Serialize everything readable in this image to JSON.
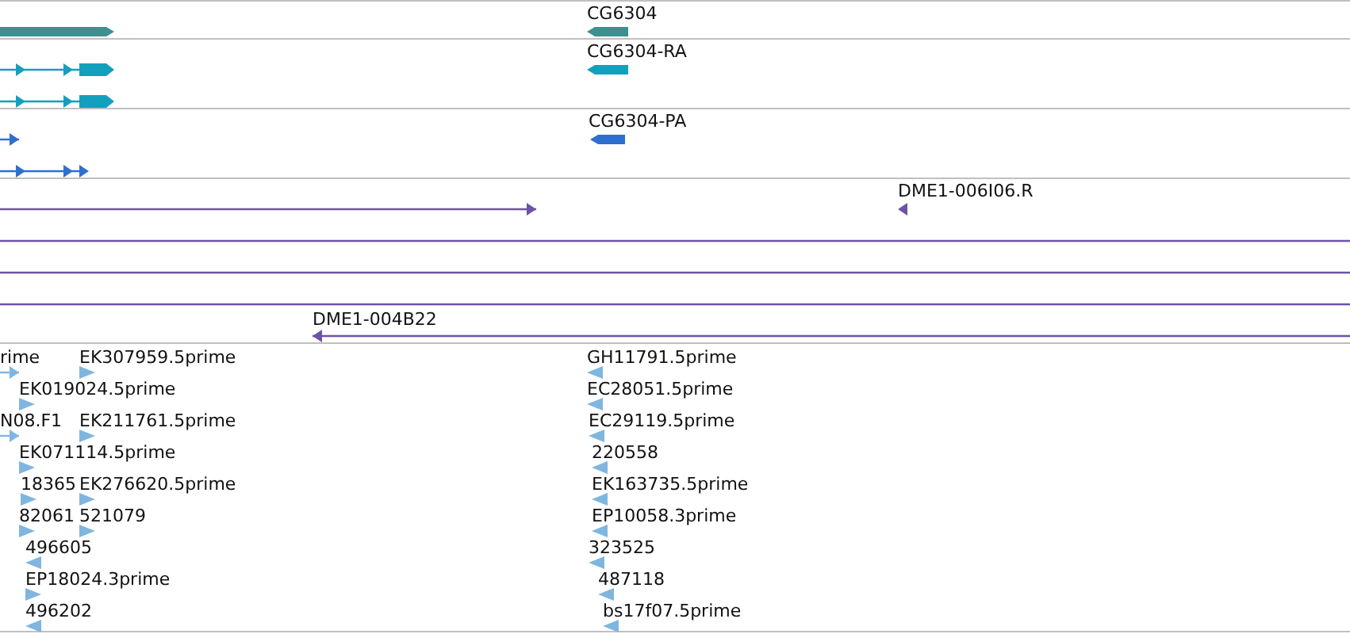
{
  "tracks": [
    {
      "color": "#3e8f8f",
      "features": [
        {
          "kind": "block",
          "forward": true
        },
        {
          "kind": "block",
          "forward": false,
          "label": "CG6304"
        }
      ]
    },
    {
      "color": "#13a0bf",
      "features": [
        {
          "kind": "transcript",
          "forward": true
        },
        {
          "kind": "transcript",
          "forward": true
        },
        {
          "kind": "block",
          "forward": false,
          "label": "CG6304-RA"
        }
      ]
    },
    {
      "color": "#2f6fcf",
      "features": [
        {
          "kind": "line",
          "forward": true
        },
        {
          "kind": "transcript",
          "forward": true
        },
        {
          "kind": "block",
          "forward": false,
          "label": "CG6304-PA"
        }
      ]
    },
    {
      "color": "#6e52a8",
      "features": [
        {
          "kind": "line",
          "forward": true
        },
        {
          "kind": "marker",
          "forward": false,
          "label": "DME1-006I06.R"
        },
        {
          "kind": "rule"
        },
        {
          "kind": "rule"
        },
        {
          "kind": "rule"
        },
        {
          "kind": "line",
          "forward": false,
          "label": "DME1-004B22"
        }
      ]
    },
    {
      "color": "#7fb6e0",
      "features": [
        {
          "kind": "line",
          "forward": true,
          "label": "rime"
        },
        {
          "kind": "marker",
          "forward": true,
          "label": "EK307959.5prime"
        },
        {
          "kind": "marker",
          "forward": false,
          "label": "GH11791.5prime"
        },
        {
          "kind": "marker",
          "forward": true,
          "label": "EK019024.5prime"
        },
        {
          "kind": "marker",
          "forward": false,
          "label": "EC28051.5prime"
        },
        {
          "kind": "line",
          "forward": true,
          "label": "N08.F1"
        },
        {
          "kind": "marker",
          "forward": true,
          "label": "EK211761.5prime"
        },
        {
          "kind": "marker",
          "forward": false,
          "label": "EC29119.5prime"
        },
        {
          "kind": "marker",
          "forward": true,
          "label": "EK071114.5prime"
        },
        {
          "kind": "marker",
          "forward": false,
          "label": "220558"
        },
        {
          "kind": "marker",
          "forward": true,
          "label": "18365"
        },
        {
          "kind": "marker",
          "forward": true,
          "label": "EK276620.5prime"
        },
        {
          "kind": "marker",
          "forward": false,
          "label": "EK163735.5prime"
        },
        {
          "kind": "marker",
          "forward": true,
          "label": "82061"
        },
        {
          "kind": "marker",
          "forward": true,
          "label": "521079"
        },
        {
          "kind": "marker",
          "forward": false,
          "label": "EP10058.3prime"
        },
        {
          "kind": "marker",
          "forward": false,
          "label": "496605"
        },
        {
          "kind": "marker",
          "forward": false,
          "label": "323525"
        },
        {
          "kind": "marker",
          "forward": true,
          "label": "EP18024.3prime"
        },
        {
          "kind": "marker",
          "forward": false,
          "label": "487118"
        },
        {
          "kind": "marker",
          "forward": false,
          "label": "496202"
        },
        {
          "kind": "marker",
          "forward": false,
          "label": "bs17f07.5prime"
        }
      ]
    }
  ]
}
